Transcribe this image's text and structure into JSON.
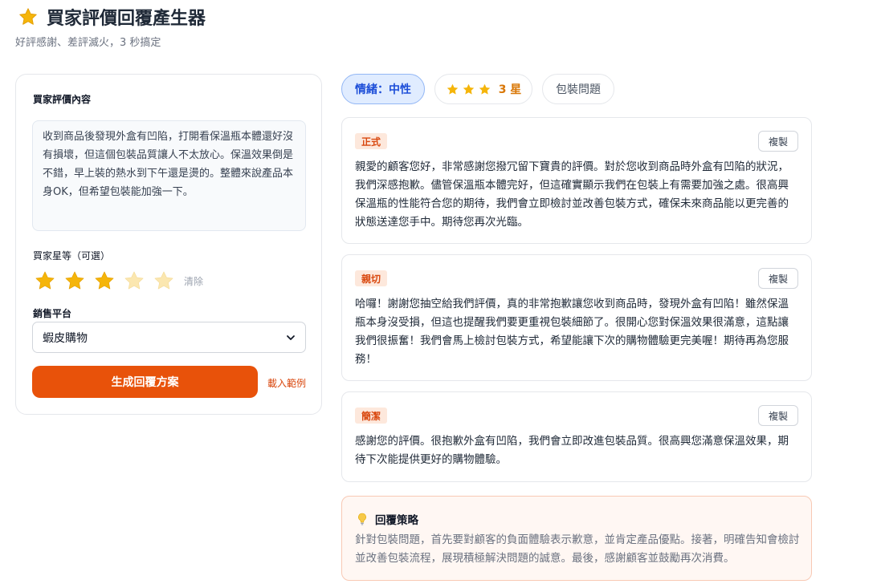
{
  "header": {
    "title": "買家評價回覆產生器",
    "subtitle": "好評感謝、差評滅火，3 秒搞定",
    "icon": "star-icon"
  },
  "form": {
    "review_label": "買家評價內容",
    "review_text": "收到商品後發現外盒有凹陷，打開看保溫瓶本體還好沒有損壞，但這個包裝品質讓人不太放心。保溫效果倒是不錯，早上裝的熱水到下午還是燙的。整體來說產品本身OK，但希望包裝能加強一下。",
    "rating_label": "買家星等（可選）",
    "rating": 3,
    "rating_max": 5,
    "clear_label": "清除",
    "platform_label": "銷售平台",
    "platform_value": "蝦皮購物",
    "generate_label": "生成回覆方案",
    "sample_label": "載入範例"
  },
  "analysis": {
    "mood": "情緒：中性",
    "stars_label": "3 星",
    "star_count": 3,
    "topic": "包裝問題"
  },
  "replies": [
    {
      "tone": "正式",
      "copy_label": "複製",
      "text": "親愛的顧客您好，非常感謝您撥冗留下寶貴的評價。對於您收到商品時外盒有凹陷的狀況，我們深感抱歉。儘管保溫瓶本體完好，但這確實顯示我們在包裝上有需要加強之處。很高興保溫瓶的性能符合您的期待，我們會立即檢討並改善包裝方式，確保未來商品能以更完善的狀態送達您手中。期待您再次光臨。"
    },
    {
      "tone": "親切",
      "copy_label": "複製",
      "text": "哈囉！謝謝您抽空給我們評價，真的非常抱歉讓您收到商品時，發現外盒有凹陷！雖然保溫瓶本身沒受損，但這也提醒我們要更重視包裝細節了。很開心您對保溫效果很滿意，這點讓我們很振奮！我們會馬上檢討包裝方式，希望能讓下次的購物體驗更完美喔！期待再為您服務！"
    },
    {
      "tone": "簡潔",
      "copy_label": "複製",
      "text": "感謝您的評價。很抱歉外盒有凹陷，我們會立即改進包裝品質。很高興您滿意保溫效果，期待下次能提供更好的購物體驗。"
    }
  ],
  "strategy": {
    "title": "回覆策略",
    "text": "針對包裝問題，首先要對顧客的負面體驗表示歉意，並肯定產品優點。接著，明確告知會檢討並改善包裝流程，展現積極解決問題的誠意。最後，感謝顧客並鼓勵再次消費。"
  },
  "colors": {
    "accent": "#e8520a",
    "star_on": "#f5b50a",
    "star_off": "#fbe7b0",
    "mood_bg": "#e0ecff",
    "mood_text": "#1d4ed8"
  }
}
